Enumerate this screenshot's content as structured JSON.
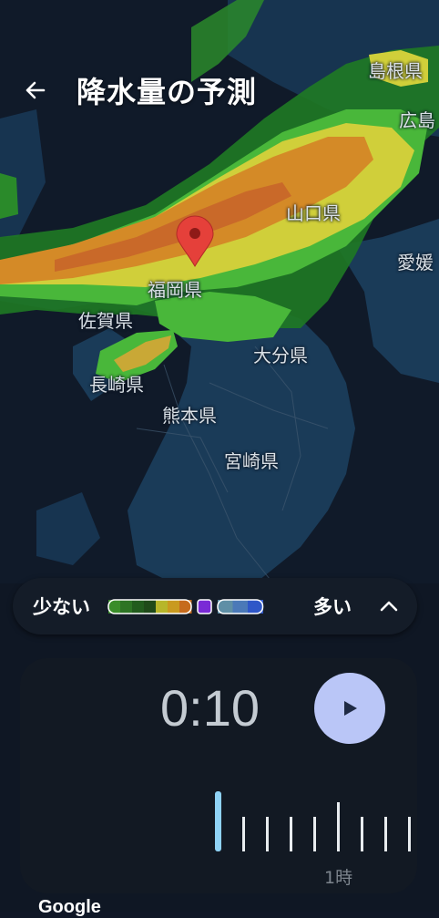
{
  "header": {
    "title": "降水量の予測",
    "back_icon": "arrow-left-icon"
  },
  "map": {
    "labels": {
      "shimane": "島根県",
      "hiroshima": "広島",
      "yamaguchi": "山口県",
      "ehime": "愛媛",
      "fukuoka": "福岡県",
      "saga": "佐賀県",
      "oita": "大分県",
      "nagasaki": "長崎県",
      "kumamoto": "熊本県",
      "miyazaki": "宮崎県"
    },
    "pin_icon": "location-pin-icon",
    "attribution": "Google"
  },
  "legend": {
    "less_label": "少ない",
    "more_label": "多い",
    "toggle_icon": "chevron-up-icon",
    "colors": [
      "#3a8d2a",
      "#2d7424",
      "#225c1d",
      "#1f4a19",
      "#b7b62a",
      "#c99a1f",
      "#c66b1d",
      "#7a2ad6",
      "#5f8fa6",
      "#4b79b8",
      "#2f57c8"
    ]
  },
  "playback": {
    "time": "0:10",
    "play_icon": "play-icon",
    "hour_label": "1時",
    "current_fraction": 0.0
  },
  "colors": {
    "accent": "#bac6f7",
    "current_tick": "#8fd2f5",
    "background": "#101726"
  }
}
